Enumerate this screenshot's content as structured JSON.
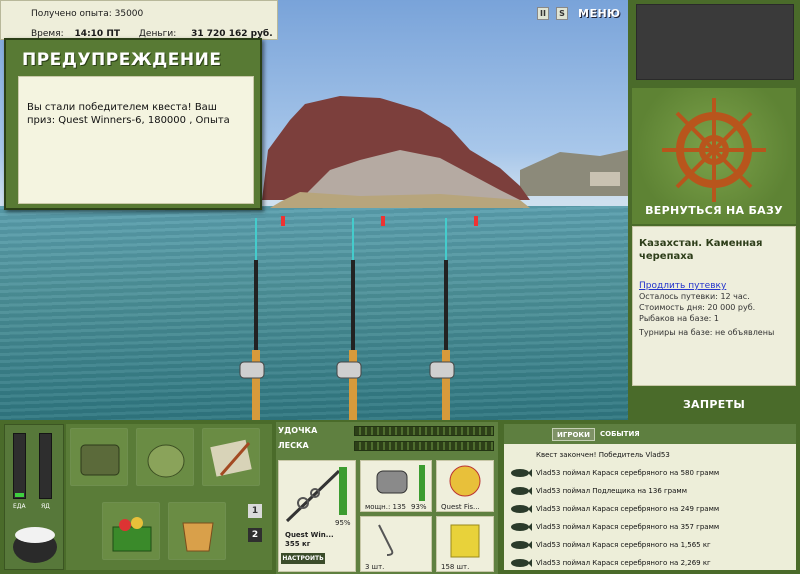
{
  "info": {
    "xp_label": "Получено опыта:",
    "xp_value": "35000",
    "time_label": "Время:",
    "time_value": "14:10 ПТ",
    "money_label": "Деньги:",
    "money_value": "31 720 162 руб."
  },
  "warning": {
    "title": "ПРЕДУПРЕЖДЕНИЕ",
    "message": "Вы стали победителем квеста! Ваш приз: Quest Winners-6, 180000 , Опыта"
  },
  "controls": {
    "pause": "II",
    "sound": "S",
    "menu": "МЕНЮ"
  },
  "right_panel": {
    "home_button": "ВЕРНУТЬСЯ НА БАЗУ",
    "base_name": "Казахстан. Каменная черепаха",
    "extend_link": "Продлить путевку",
    "lines": [
      "Осталось путевки: 12 час.",
      "Стоимость дня: 20 000 руб.",
      "Рыбаков на базе: 1",
      "Турниры на базе: не объявлены"
    ],
    "bans_button": "ЗАПРЕТЫ"
  },
  "meters": {
    "food_label": "ЕДА",
    "poison_label": "ЯД",
    "food_level": 0.06,
    "poison_level": 0.0
  },
  "inventory": {
    "pages": [
      "1",
      "2"
    ]
  },
  "rod_panel": {
    "rod_label": "УДОЧКА",
    "line_label": "ЛЕСКА",
    "rod_name": "Quest Win...",
    "rod_weight": "355 кг",
    "rod_percent": "95%",
    "reel_power": "мощн.: 135",
    "reel_percent": "93%",
    "line_name": "Quest Fis...",
    "hooks_count": "3 шт.",
    "bait_count": "158 шт.",
    "setup_button": "НАСТРОИТЬ"
  },
  "log": {
    "tabs": [
      "ИГРОКИ",
      "СОБЫТИЯ"
    ],
    "lines": [
      "Квест закончен! Победитель Vlad53",
      "Vlad53 поймал Карася серебряного на 580 грамм",
      "Vlad53 поймал Подлещика на 136 грамм",
      "Vlad53 поймал Карася серебряного на 249 грамм",
      "Vlad53 поймал Карася серебряного на 357 грамм",
      "Vlad53 поймал Карася серебряного на 1,565 кг",
      "Vlad53 поймал Карася серебряного на 2,269 кг"
    ]
  }
}
